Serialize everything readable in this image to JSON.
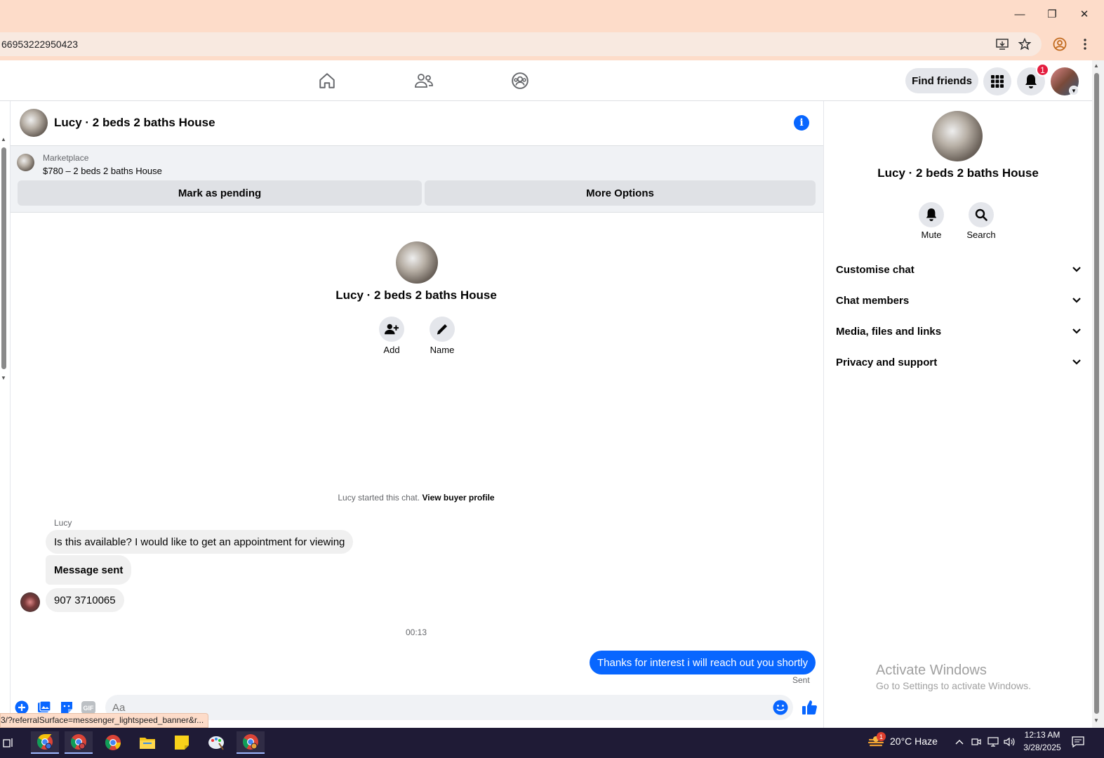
{
  "browser": {
    "url_fragment": "66953222950423",
    "status_url": "3/?referralSurface=messenger_lightspeed_banner&r..."
  },
  "nav": {
    "find_friends": "Find friends",
    "notification_count": "1"
  },
  "chat": {
    "title": "Lucy · 2 beds 2 baths House",
    "marketplace": {
      "label": "Marketplace",
      "listing": "$780 – 2 beds 2 baths House",
      "mark_pending": "Mark as pending",
      "more_options": "More Options"
    },
    "profile": {
      "name": "Lucy · 2 beds 2 baths House",
      "add_label": "Add",
      "name_label": "Name"
    },
    "started_text": "Lucy started this chat.",
    "view_buyer_profile": "View buyer profile",
    "sender_name": "Lucy",
    "messages": [
      "Is this available? I would like to get an appointment for viewing",
      "Message sent",
      "907 3710065"
    ],
    "timestamp": "00:13",
    "outgoing": "Thanks for interest i will reach out you shortly",
    "sent_label": "Sent",
    "composer_placeholder": "Aa",
    "gif_label": "GIF"
  },
  "right_panel": {
    "title": "Lucy · 2 beds 2 baths House",
    "mute": "Mute",
    "search": "Search",
    "sections": [
      "Customise chat",
      "Chat members",
      "Media, files and links",
      "Privacy and support"
    ]
  },
  "windows": {
    "activate_title": "Activate Windows",
    "activate_sub": "Go to Settings to activate Windows.",
    "weather": "20°C  Haze",
    "weather_badge": "1",
    "time": "12:13 AM",
    "date": "3/28/2025"
  },
  "colors": {
    "accent": "#0866ff",
    "titlebar": "#fddcc9",
    "taskbar": "#1f1b36"
  }
}
